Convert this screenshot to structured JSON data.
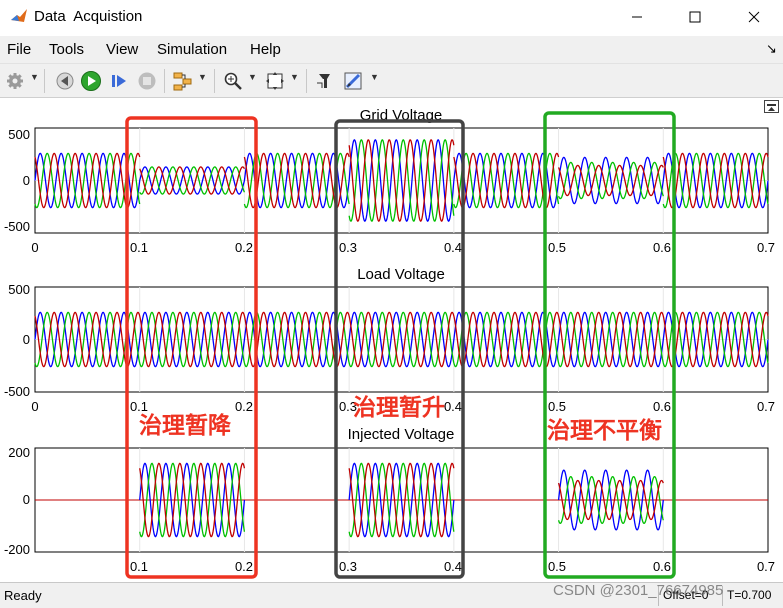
{
  "window": {
    "title": "Data  Acquistion"
  },
  "menu": [
    "File",
    "Tools",
    "View",
    "Simulation",
    "Help"
  ],
  "toolbar_icons": [
    "gear-icon",
    "step-back-icon",
    "run-icon",
    "step-forward-icon",
    "stop-icon",
    "signal-hierarchy-icon",
    "zoom-icon",
    "autoscale-icon",
    "highlight-block-icon",
    "style-icon"
  ],
  "plots": [
    {
      "title": "Grid Voltage",
      "y_ticks": [
        "500",
        "0",
        "-500"
      ],
      "x_ticks": [
        "0",
        "0.1",
        "0.2",
        "0.3",
        "0.4",
        "0.5",
        "0.6",
        "0.7"
      ]
    },
    {
      "title": "Load Voltage",
      "y_ticks": [
        "500",
        "0",
        "-500"
      ],
      "x_ticks": [
        "0",
        "0.1",
        "0.2",
        "0.3",
        "0.4",
        "0.5",
        "0.6",
        "0.7"
      ]
    },
    {
      "title": "Injected Voltage",
      "y_ticks": [
        "200",
        "0",
        "-200"
      ],
      "x_ticks": [
        "0.1",
        "0.2",
        "0.3",
        "0.4",
        "0.5",
        "0.6",
        "0.7"
      ]
    }
  ],
  "chart_data": [
    {
      "type": "line",
      "title": "Grid Voltage",
      "xlim": [
        0,
        0.7
      ],
      "ylim": [
        -600,
        600
      ],
      "series_colors": [
        "#0000ff",
        "#00c000",
        "#c00000"
      ],
      "segments": [
        {
          "x": [
            0.0,
            0.1
          ],
          "amplitude": 310
        },
        {
          "x": [
            0.1,
            0.2
          ],
          "amplitude": 155
        },
        {
          "x": [
            0.2,
            0.3
          ],
          "amplitude": 310
        },
        {
          "x": [
            0.3,
            0.4
          ],
          "amplitude": 465
        },
        {
          "x": [
            0.4,
            0.5
          ],
          "amplitude": 310
        },
        {
          "x": [
            0.5,
            0.6
          ],
          "amplitude": 230,
          "unbalanced": true
        },
        {
          "x": [
            0.6,
            0.7
          ],
          "amplitude": 310
        }
      ]
    },
    {
      "type": "line",
      "title": "Load Voltage",
      "xlim": [
        0,
        0.7
      ],
      "ylim": [
        -600,
        600
      ],
      "series_colors": [
        "#0000ff",
        "#00c000",
        "#c00000"
      ],
      "segments": [
        {
          "x": [
            0.0,
            0.7
          ],
          "amplitude": 310
        }
      ]
    },
    {
      "type": "line",
      "title": "Injected Voltage",
      "xlim": [
        0,
        0.7
      ],
      "ylim": [
        -220,
        220
      ],
      "series_colors": [
        "#0000ff",
        "#00c000",
        "#c00000"
      ],
      "segments": [
        {
          "x": [
            0.1,
            0.2
          ],
          "amplitude": 155
        },
        {
          "x": [
            0.3,
            0.4
          ],
          "amplitude": 155
        },
        {
          "x": [
            0.5,
            0.6
          ],
          "amplitude": 110,
          "unbalanced": true
        }
      ]
    }
  ],
  "annotations": {
    "sag": {
      "text": "治理暂降",
      "color": "#ee3322"
    },
    "swell": {
      "text": "治理暂升",
      "color": "#ee3322"
    },
    "unbalance": {
      "text": "治理不平衡",
      "color": "#ee3322"
    }
  },
  "highlight_colors": {
    "sag": "#ee3322",
    "swell": "#444444",
    "unbalance": "#22aa22"
  },
  "status": {
    "ready": "Ready",
    "offset": "Offset=0",
    "time": "T=0.700"
  },
  "watermark": "CSDN @2301_76674985"
}
